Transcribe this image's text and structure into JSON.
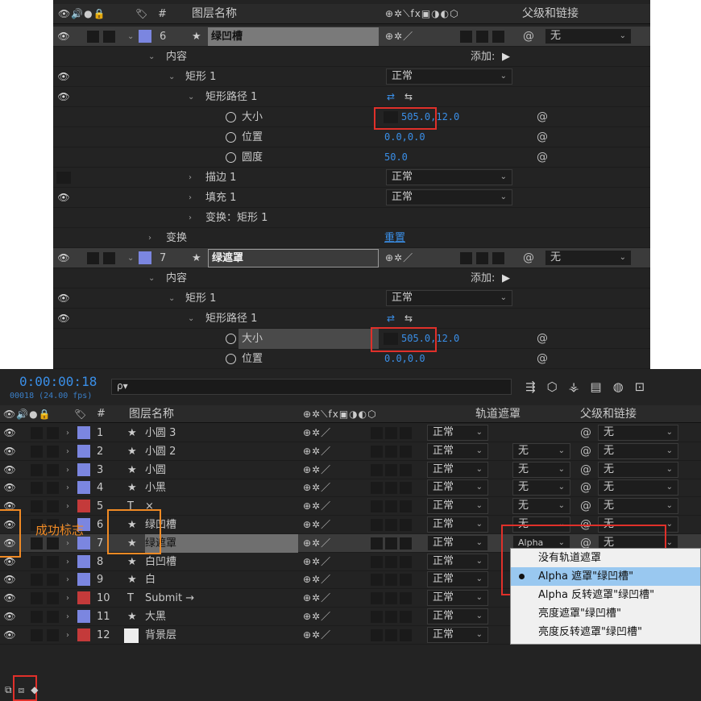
{
  "top": {
    "header": {
      "layer_name_col": "图层名称",
      "parent_col": "父级和链接",
      "hash": "#"
    },
    "add_label": "添加:",
    "rows": [
      {
        "id": "l6",
        "num": "6",
        "name": "绿凹槽",
        "parent": "无"
      },
      {
        "id": "content1",
        "label": "内容"
      },
      {
        "id": "rect1",
        "label": "矩形 1",
        "mode": "正常"
      },
      {
        "id": "rectpath1",
        "label": "矩形路径 1"
      },
      {
        "id": "size1",
        "label": "大小",
        "value": "505.0,12.0"
      },
      {
        "id": "pos1",
        "label": "位置",
        "value": "0.0,0.0"
      },
      {
        "id": "round1",
        "label": "圆度",
        "value": "50.0"
      },
      {
        "id": "stroke1",
        "label": "描边 1",
        "mode": "正常"
      },
      {
        "id": "fill1",
        "label": "填充 1",
        "mode": "正常"
      },
      {
        "id": "xform1",
        "label": "变换：矩形 1"
      },
      {
        "id": "xform",
        "label": "变换",
        "reset": "重置"
      },
      {
        "id": "l7",
        "num": "7",
        "name": "绿遮罩",
        "parent": "无"
      },
      {
        "id": "content2",
        "label": "内容"
      },
      {
        "id": "rect2",
        "label": "矩形 1",
        "mode": "正常"
      },
      {
        "id": "rectpath2",
        "label": "矩形路径 1"
      },
      {
        "id": "size2",
        "label": "大小",
        "value": "505.0,12.0"
      },
      {
        "id": "pos2",
        "label": "位置",
        "value": "0.0,0.0"
      }
    ]
  },
  "bottom": {
    "timecode": "0:00:00:18",
    "fps": "00018 (24.00 fps)",
    "search_placeholder": "ρ▾",
    "header": {
      "hash": "#",
      "layer_name_col": "图层名称",
      "track_matte_col": "轨道遮罩",
      "parent_col": "父级和链接"
    },
    "success_label": "成功标志",
    "layers": [
      {
        "num": "1",
        "type": "★",
        "name": "小圆 3",
        "mode": "正常",
        "matte": "",
        "parent": "无",
        "color": "#7b86e0"
      },
      {
        "num": "2",
        "type": "★",
        "name": "小圆 2",
        "mode": "正常",
        "matte": "无",
        "parent": "无",
        "color": "#7b86e0"
      },
      {
        "num": "3",
        "type": "★",
        "name": "小圆",
        "mode": "正常",
        "matte": "无",
        "parent": "无",
        "color": "#7b86e0"
      },
      {
        "num": "4",
        "type": "★",
        "name": "小黑",
        "mode": "正常",
        "matte": "无",
        "parent": "无",
        "color": "#7b86e0"
      },
      {
        "num": "5",
        "type": "T",
        "name": "×",
        "mode": "正常",
        "matte": "无",
        "parent": "无",
        "color": "#c43a3a"
      },
      {
        "num": "6",
        "type": "★",
        "name": "绿凹槽",
        "mode": "正常",
        "matte": "无",
        "parent": "无",
        "color": "#7b86e0"
      },
      {
        "num": "7",
        "type": "★",
        "name": "绿遮罩",
        "mode": "正常",
        "matte": "Alpha",
        "parent": "无",
        "color": "#7b86e0"
      },
      {
        "num": "8",
        "type": "★",
        "name": "白凹槽",
        "mode": "正常",
        "matte": "",
        "parent": "",
        "color": "#7b86e0"
      },
      {
        "num": "9",
        "type": "★",
        "name": "白",
        "mode": "正常",
        "matte": "",
        "parent": "",
        "color": "#7b86e0"
      },
      {
        "num": "10",
        "type": "T",
        "name": "Submit →",
        "mode": "正常",
        "matte": "",
        "parent": "",
        "color": "#c43a3a"
      },
      {
        "num": "11",
        "type": "★",
        "name": "大黑",
        "mode": "正常",
        "matte": "",
        "parent": "",
        "color": "#7b86e0"
      },
      {
        "num": "12",
        "type": "",
        "name": "背景层",
        "mode": "正常",
        "matte": "",
        "parent": "",
        "color": "#c43a3a"
      }
    ],
    "dropdown": [
      {
        "label": "没有轨道遮罩",
        "active": false
      },
      {
        "label": "Alpha 遮罩\"绿凹槽\"",
        "active": true
      },
      {
        "label": "Alpha 反转遮罩\"绿凹槽\"",
        "active": false
      },
      {
        "label": "亮度遮罩\"绿凹槽\"",
        "active": false
      },
      {
        "label": "亮度反转遮罩\"绿凹槽\"",
        "active": false
      }
    ]
  }
}
